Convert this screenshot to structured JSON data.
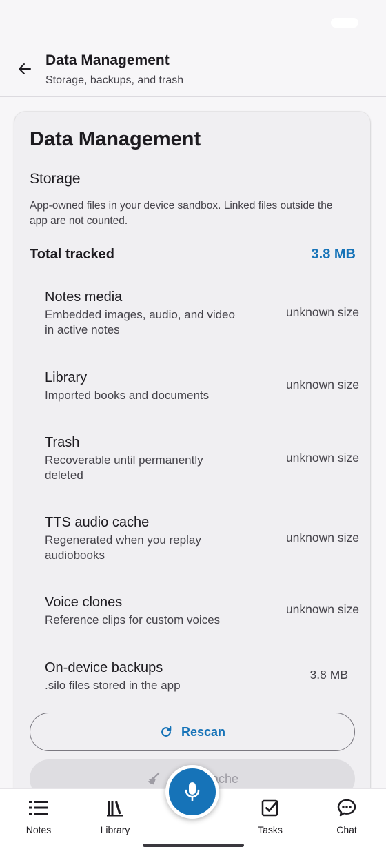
{
  "app_bar": {
    "title": "Data Management",
    "subtitle": "Storage, backups, and trash"
  },
  "card": {
    "title": "Data Management",
    "section_title": "Storage",
    "section_desc": "App-owned files in your device sandbox. Linked files outside the app are not counted.",
    "total_label": "Total tracked",
    "total_value": "3.8 MB",
    "items": [
      {
        "name": "Notes media",
        "desc": "Embedded images, audio, and video in active notes",
        "size": "unknown size"
      },
      {
        "name": "Library",
        "desc": "Imported books and documents",
        "size": "unknown size"
      },
      {
        "name": "Trash",
        "desc": "Recoverable until permanently deleted",
        "size": "unknown size"
      },
      {
        "name": "TTS audio cache",
        "desc": "Regenerated when you replay audiobooks",
        "size": "unknown size"
      },
      {
        "name": "Voice clones",
        "desc": "Reference clips for custom voices",
        "size": "unknown size"
      },
      {
        "name": "On-device backups",
        "desc": ".silo files stored in the app",
        "size": "3.8 MB"
      }
    ],
    "rescan_label": "Rescan",
    "clear_cache_label": "Clear Cache"
  },
  "nav": {
    "notes": "Notes",
    "library": "Library",
    "tasks": "Tasks",
    "chat": "Chat"
  },
  "colors": {
    "accent": "#1673b8",
    "background": "#f7f6f8",
    "card": "#f0eff2"
  }
}
